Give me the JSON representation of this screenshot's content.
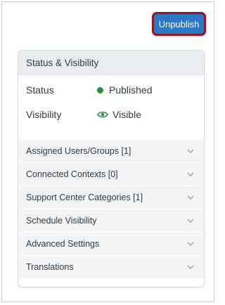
{
  "actions": {
    "unpublish_label": "Unpublish"
  },
  "panel": {
    "title": "Status & Visibility",
    "status": {
      "label": "Status",
      "value": "Published",
      "color": "#2b8a3e"
    },
    "visibility": {
      "label": "Visibility",
      "value": "Visible",
      "icon": "eye-icon"
    }
  },
  "sections": [
    {
      "label": "Assigned Users/Groups [1]"
    },
    {
      "label": "Connected Contexts [0]"
    },
    {
      "label": "Support Center Categories [1]"
    },
    {
      "label": "Schedule Visibility"
    },
    {
      "label": "Advanced Settings"
    },
    {
      "label": "Translations"
    }
  ],
  "colors": {
    "accent": "#2a77c6",
    "focus_ring": "#8b1c26",
    "success": "#2b8a3e"
  }
}
